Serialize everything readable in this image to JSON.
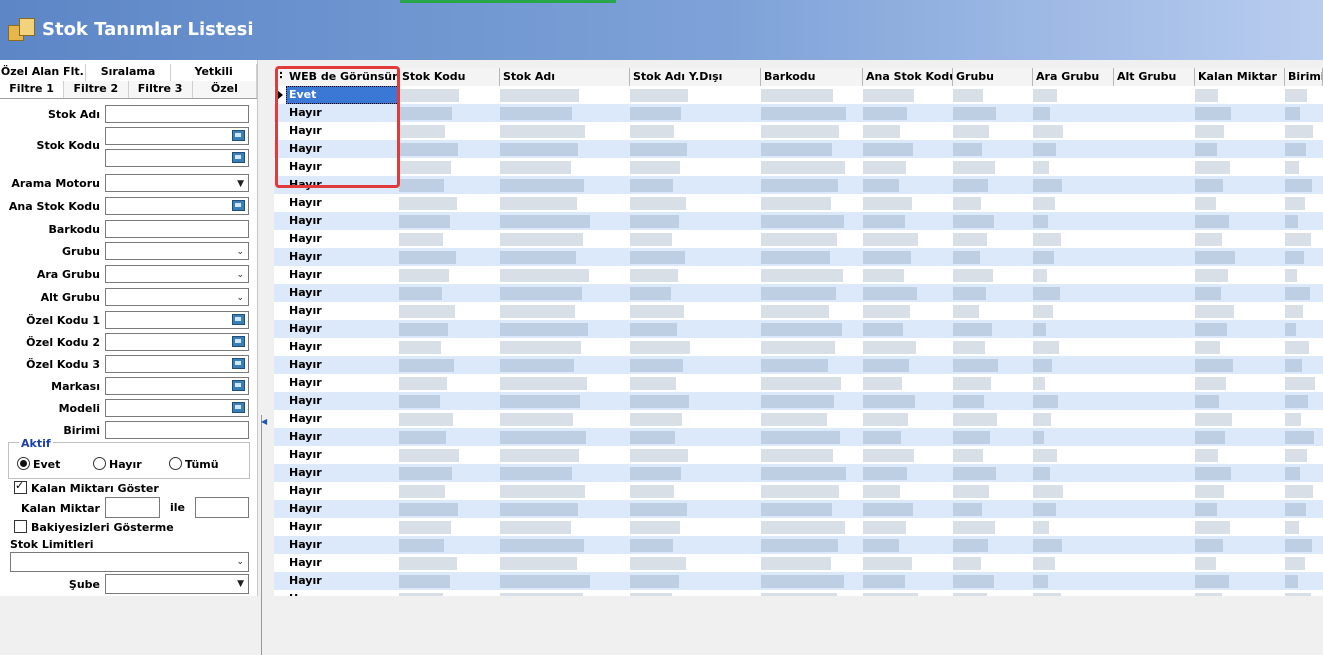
{
  "window": {
    "title": "Stok Tanımlar Listesi"
  },
  "tabs_row1": [
    "Özel Alan Flt.",
    "Sıralama",
    "Yetkili"
  ],
  "tabs_row2": [
    "Filtre 1",
    "Filtre 2",
    "Filtre 3",
    "Özel"
  ],
  "active_tab": "Filtre 1",
  "filters": {
    "stok_adi": "Stok Adı",
    "stok_kodu": "Stok Kodu",
    "arama_motoru": "Arama Motoru",
    "ana_stok_kodu": "Ana Stok Kodu",
    "barkodu": "Barkodu",
    "grubu": "Grubu",
    "ara_grubu": "Ara Grubu",
    "alt_grubu": "Alt Grubu",
    "ozel_kodu_1": "Özel Kodu 1",
    "ozel_kodu_2": "Özel Kodu 2",
    "ozel_kodu_3": "Özel Kodu 3",
    "markasi": "Markası",
    "modeli": "Modeli",
    "birimi": "Birimi",
    "aktif_title": "Aktif",
    "radio_evet": "Evet",
    "radio_hayir": "Hayır",
    "radio_tumu": "Tümü",
    "aktif_selected": "Evet",
    "kalan_miktari_goster": "Kalan Miktarı Göster",
    "kalan_miktari_goster_checked": true,
    "kalan_miktar": "Kalan Miktar",
    "ile": "ile",
    "bakiyesizleri_gosterme": "Bakiyesizleri Gösterme",
    "bakiyesizleri_checked": false,
    "stok_limitleri": "Stok Limitleri",
    "sube": "Şube"
  },
  "grid": {
    "columns": [
      "WEB de Görünsün",
      "Stok Kodu",
      "Stok Adı",
      "Stok Adı Y.Dışı",
      "Barkodu",
      "Ana Stok Kodu",
      "Grubu",
      "Ara Grubu",
      "Alt Grubu",
      "Kalan Miktar",
      "Birimi"
    ],
    "web_values": [
      "Evet",
      "Hayır",
      "Hayır",
      "Hayır",
      "Hayır",
      "Hayır",
      "Hayır",
      "Hayır",
      "Hayır",
      "Hayır",
      "Hayır",
      "Hayır",
      "Hayır",
      "Hayır",
      "Hayır",
      "Hayır",
      "Hayır",
      "Hayır",
      "Hayır",
      "Hayır",
      "Hayır",
      "Hayır",
      "Hayır",
      "Hayır",
      "Hayır",
      "Hayır",
      "Hayır",
      "Hayır",
      "Hayır"
    ],
    "selected_row": 0
  },
  "colors": {
    "highlight": "#e03a3a",
    "selection": "#3b78d6",
    "row_alt": "#dbe9fb"
  }
}
